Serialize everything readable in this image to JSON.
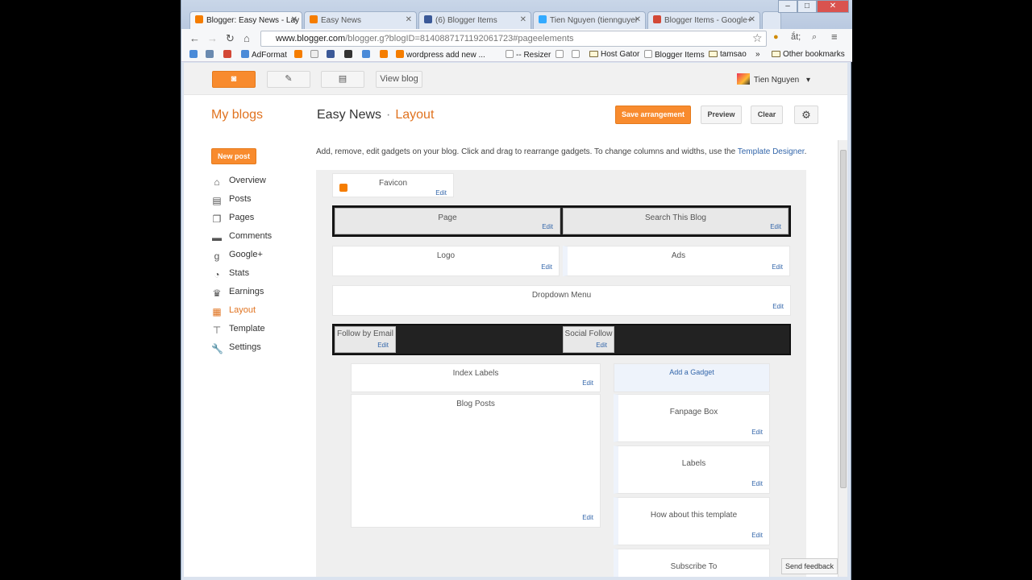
{
  "browser": {
    "tabs": [
      {
        "label": "Blogger: Easy News - Lay",
        "active": true
      },
      {
        "label": "Easy News",
        "active": false
      },
      {
        "label": "(6) Blogger Items",
        "active": false
      },
      {
        "label": "Tien Nguyen (tiennguyer",
        "active": false
      },
      {
        "label": "Blogger Items - Google+",
        "active": false
      }
    ],
    "url_host": "www.blogger.com",
    "url_path": "/blogger.g?blogID=8140887171192061723#pageelements",
    "lang_label": "ắt;",
    "bookmarks": [
      "AdFormat",
      "wordpress add new ...",
      "-- Resizer",
      "Host Gator",
      "Blogger Items",
      "tamsao"
    ],
    "other_bookmarks": "Other bookmarks"
  },
  "topbar": {
    "view_blog": "View blog",
    "user_name": "Tien Nguyen"
  },
  "header": {
    "my_blogs": "My blogs",
    "blog_name": "Easy News",
    "separator": "·",
    "section": "Layout",
    "save": "Save arrangement",
    "preview": "Preview",
    "clear": "Clear"
  },
  "sidebar": {
    "new_post": "New post",
    "items": [
      {
        "label": "Overview",
        "icon": "home-icon"
      },
      {
        "label": "Posts",
        "icon": "posts-icon"
      },
      {
        "label": "Pages",
        "icon": "pages-icon"
      },
      {
        "label": "Comments",
        "icon": "comments-icon"
      },
      {
        "label": "Google+",
        "icon": "google-plus-icon"
      },
      {
        "label": "Stats",
        "icon": "stats-icon"
      },
      {
        "label": "Earnings",
        "icon": "trophy-icon"
      },
      {
        "label": "Layout",
        "icon": "layout-icon",
        "active": true
      },
      {
        "label": "Template",
        "icon": "template-icon"
      },
      {
        "label": "Settings",
        "icon": "wrench-icon"
      }
    ]
  },
  "intro": {
    "text": "Add, remove, edit gadgets on your blog. Click and drag to rearrange gadgets. To change columns and widths, use the ",
    "link": "Template Designer",
    "end": "."
  },
  "layout": {
    "edit": "Edit",
    "favicon": "Favicon",
    "page": "Page",
    "search": "Search This Blog",
    "logo": "Logo",
    "ads": "Ads",
    "dropdown": "Dropdown Menu",
    "follow_email": "Follow by Email",
    "social_follow": "Social Follow",
    "index_labels": "Index Labels",
    "blog_posts": "Blog Posts",
    "add_gadget": "Add a Gadget",
    "fanpage": "Fanpage Box",
    "labels": "Labels",
    "how_about": "How about this template",
    "subscribe": "Subscribe To"
  },
  "feedback": "Send feedback",
  "colors": {
    "accent": "#f88b2e",
    "link": "#3366aa"
  }
}
